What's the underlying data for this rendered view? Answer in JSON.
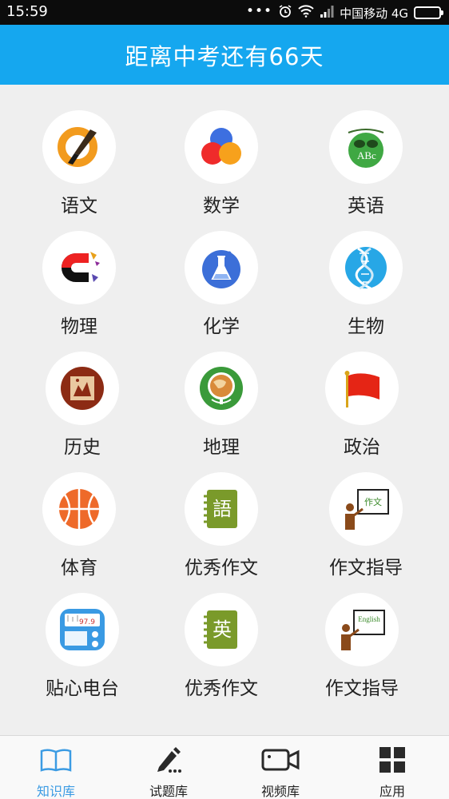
{
  "status_bar": {
    "time": "15:59",
    "dots": "•••",
    "carrier": "中国移动 4G"
  },
  "header": {
    "title": "距离中考还有66天"
  },
  "subjects": [
    {
      "label": "语文",
      "icon": "brush-icon"
    },
    {
      "label": "数学",
      "icon": "color-circles-icon"
    },
    {
      "label": "英语",
      "icon": "abc-globe-icon"
    },
    {
      "label": "物理",
      "icon": "magnet-icon"
    },
    {
      "label": "化学",
      "icon": "flask-icon"
    },
    {
      "label": "生物",
      "icon": "dna-icon"
    },
    {
      "label": "历史",
      "icon": "ancient-seal-icon"
    },
    {
      "label": "地理",
      "icon": "globe-icon"
    },
    {
      "label": "政治",
      "icon": "red-flag-icon"
    },
    {
      "label": "体育",
      "icon": "basketball-icon"
    },
    {
      "label": "优秀作文",
      "icon": "chinese-notebook-icon",
      "glyph": "語"
    },
    {
      "label": "作文指导",
      "icon": "teacher-board-icon",
      "glyph": "作文"
    },
    {
      "label": "贴心电台",
      "icon": "radio-icon",
      "freq": "97.9"
    },
    {
      "label": "优秀作文",
      "icon": "english-notebook-icon",
      "glyph": "英"
    },
    {
      "label": "作文指导",
      "icon": "teacher-board-english-icon",
      "glyph": "English"
    }
  ],
  "nav": [
    {
      "label": "知识库",
      "icon": "book-icon",
      "active": true
    },
    {
      "label": "试题库",
      "icon": "pencil-icon",
      "active": false
    },
    {
      "label": "视频库",
      "icon": "video-camera-icon",
      "active": false
    },
    {
      "label": "应用",
      "icon": "apps-grid-icon",
      "active": false
    }
  ],
  "colors": {
    "header": "#15a7ef",
    "nav_active": "#3b9be3",
    "background": "#efefef"
  }
}
